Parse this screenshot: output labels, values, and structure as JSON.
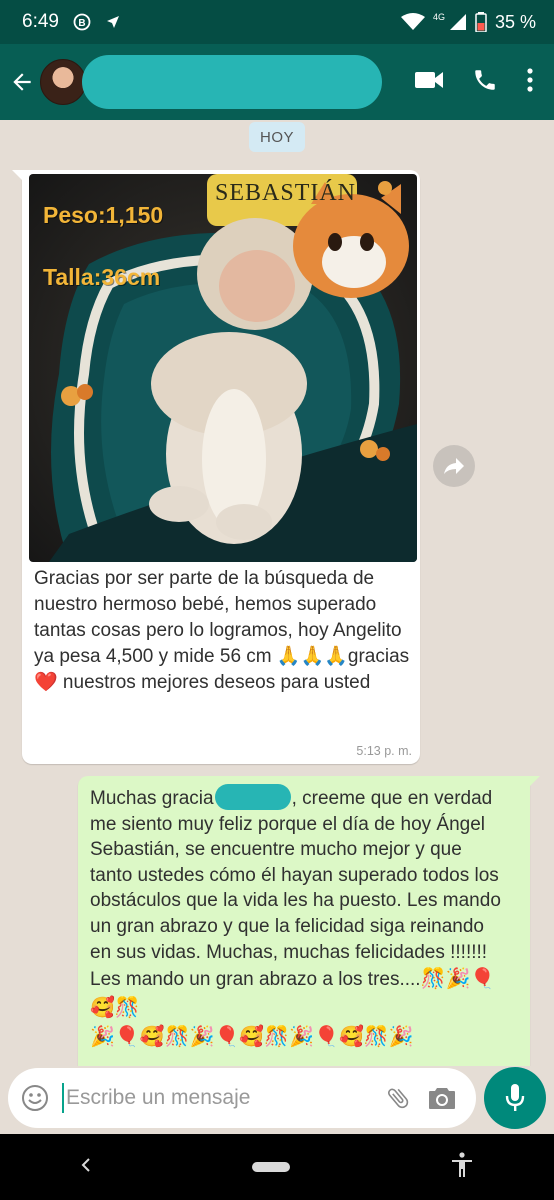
{
  "status_bar": {
    "time": "6:49",
    "network": "4G",
    "battery": "35 %",
    "icons": [
      "whatsapp-notification-icon",
      "location-arrow-icon",
      "wifi-icon",
      "cell-signal-icon",
      "battery-icon"
    ]
  },
  "header": {
    "icons": [
      "back-arrow-icon",
      "video-call-icon",
      "phone-icon",
      "more-vert-icon"
    ]
  },
  "chat": {
    "date_chip": "HOY",
    "incoming": {
      "photo_overlay": {
        "weight": "Peso:1,150",
        "height": "Talla:36cm",
        "pillow_text": "SEBASTIÁN"
      },
      "text": "Gracias por ser parte de la búsqueda de nuestro hermoso bebé, hemos superado tantas cosas pero lo logramos, hoy Angelito ya pesa 4,500 y mide 56 cm 🙏🙏🙏gracias❤️ nuestros mejores deseos para usted",
      "time": "5:13 p. m."
    },
    "outgoing": {
      "text_before_redaction": "Muchas gracia",
      "text_after_redaction": ", creeme que en verdad me siento muy feliz porque el día de hoy Ángel Sebastián,  se encuentre mucho mejor y que tanto ustedes cómo él hayan superado todos los obstáculos que la vida les ha puesto. Les mando un gran abrazo y que la felicidad siga reinando en sus vidas. Muchas, muchas felicidades !!!!!!! Les mando un gran abrazo a los tres....",
      "emoji_line_1": "🎊🎉🎈🥰🎊",
      "emoji_line_2": "🎉🎈🥰🎊🎉🎈🥰🎊🎉🎈🥰🎊🎉"
    }
  },
  "input": {
    "placeholder": "Escribe un mensaje"
  },
  "nav": {
    "icons": [
      "back-nav-icon",
      "home-pill-icon",
      "accessibility-icon"
    ]
  },
  "colors": {
    "status_bar": "#054d44",
    "header": "#075e54",
    "chat_bg": "#e5ddd5",
    "incoming_bubble": "#ffffff",
    "outgoing_bubble": "#dcf8c6",
    "accent": "#00897b",
    "redaction": "#27b5b4"
  }
}
